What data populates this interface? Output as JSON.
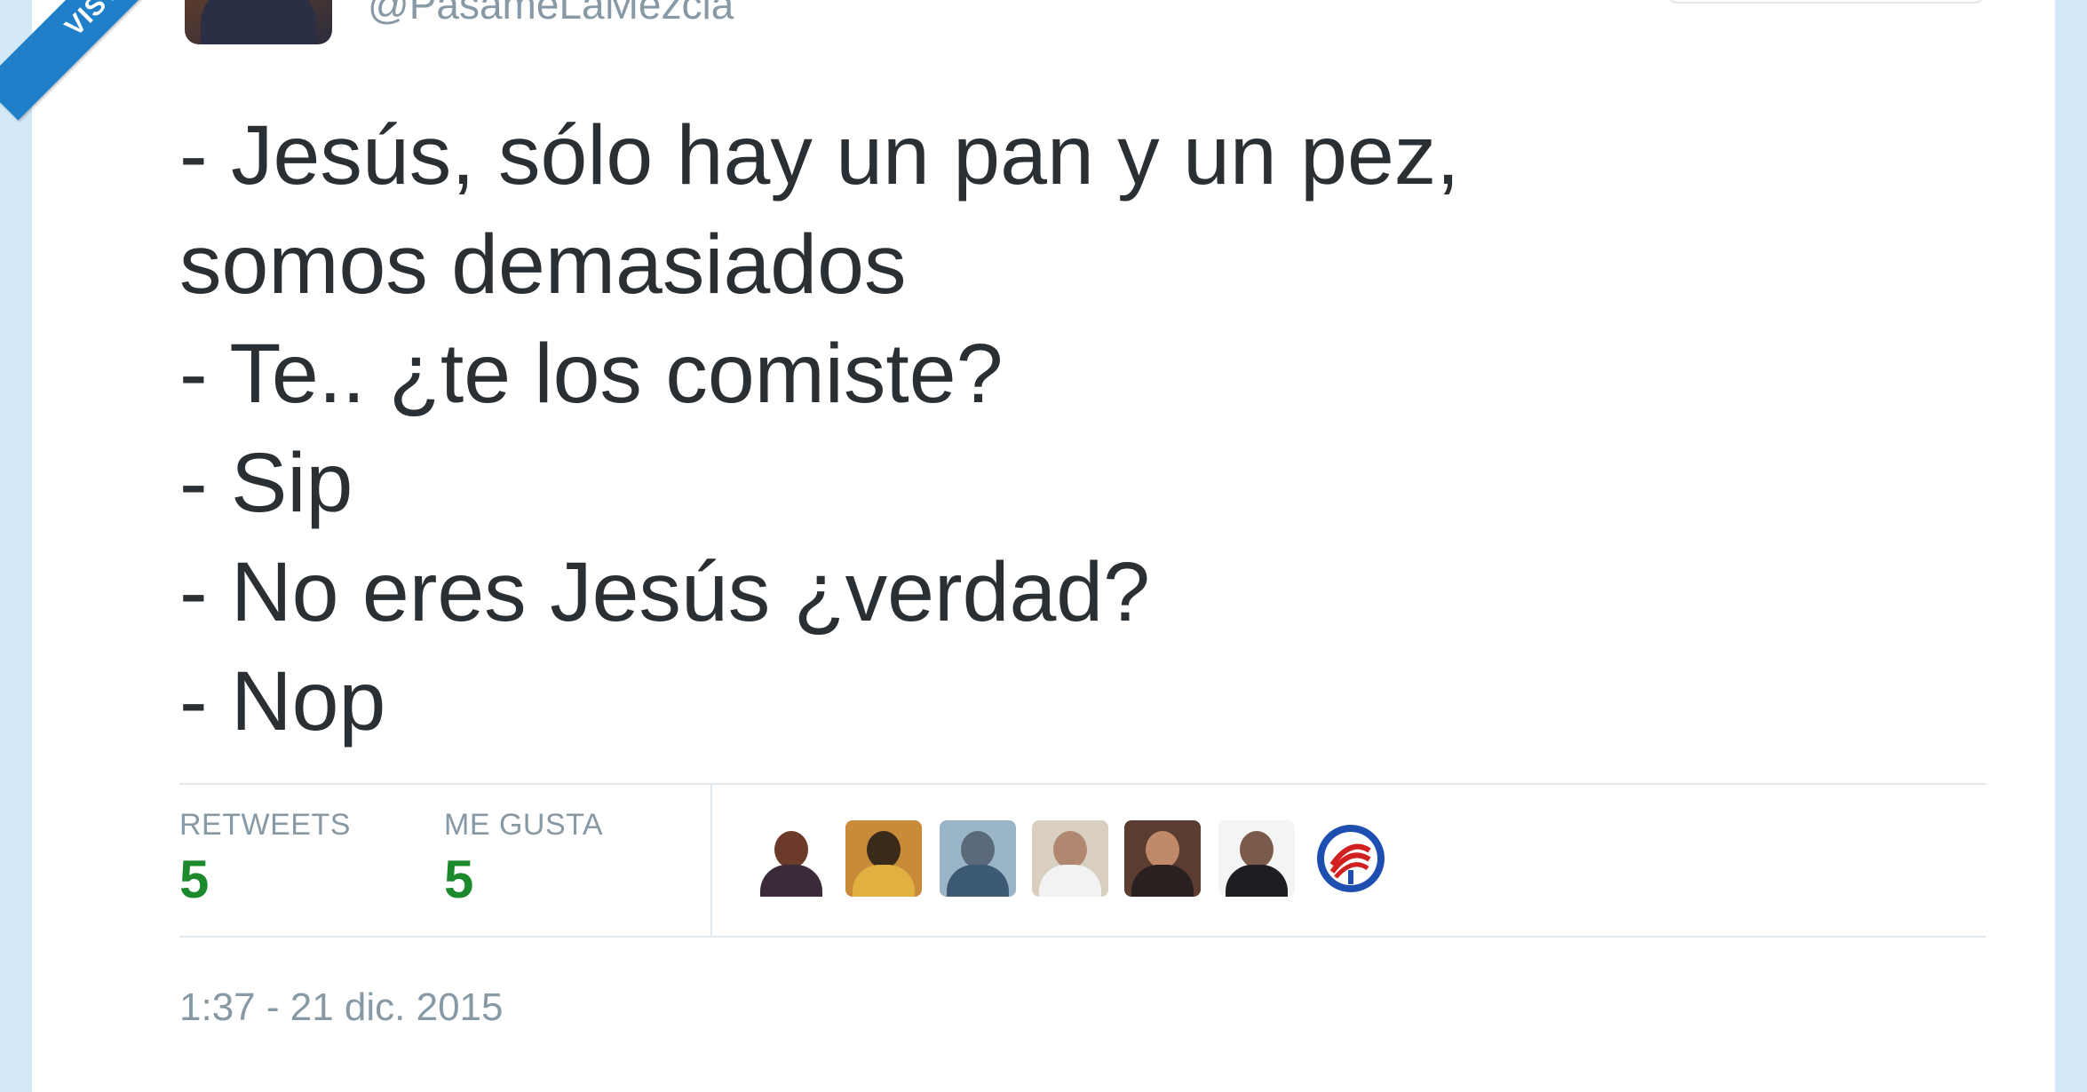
{
  "badge": {
    "text": "VISTO"
  },
  "author": {
    "handle": "@PasameLaMezcla"
  },
  "tweet": {
    "lines": [
      "- Jesús, sólo hay un pan y un pez,",
      "somos demasiados",
      "- Te.. ¿te los comiste?",
      "- Sip",
      "- No eres Jesús ¿verdad?",
      "- Nop"
    ]
  },
  "stats": {
    "retweets_label": "RETWEETS",
    "retweets_value": "5",
    "likes_label": "ME GUSTA",
    "likes_value": "5"
  },
  "timestamp": "1:37 - 21 dic. 2015",
  "colors": {
    "page_background": "#d4e9f7",
    "badge": "#1f7fc8",
    "text": "#292f33",
    "muted": "#8899a6",
    "stat_value": "#1c8a2c",
    "divider": "#e1e8ed"
  }
}
